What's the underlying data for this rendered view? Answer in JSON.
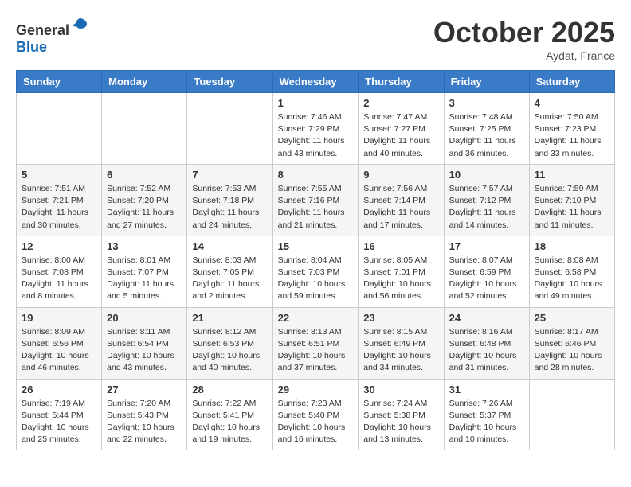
{
  "header": {
    "logo_general": "General",
    "logo_blue": "Blue",
    "month": "October 2025",
    "location": "Aydat, France"
  },
  "columns": [
    "Sunday",
    "Monday",
    "Tuesday",
    "Wednesday",
    "Thursday",
    "Friday",
    "Saturday"
  ],
  "weeks": [
    [
      {
        "day": "",
        "info": ""
      },
      {
        "day": "",
        "info": ""
      },
      {
        "day": "",
        "info": ""
      },
      {
        "day": "1",
        "info": "Sunrise: 7:46 AM\nSunset: 7:29 PM\nDaylight: 11 hours and 43 minutes."
      },
      {
        "day": "2",
        "info": "Sunrise: 7:47 AM\nSunset: 7:27 PM\nDaylight: 11 hours and 40 minutes."
      },
      {
        "day": "3",
        "info": "Sunrise: 7:48 AM\nSunset: 7:25 PM\nDaylight: 11 hours and 36 minutes."
      },
      {
        "day": "4",
        "info": "Sunrise: 7:50 AM\nSunset: 7:23 PM\nDaylight: 11 hours and 33 minutes."
      }
    ],
    [
      {
        "day": "5",
        "info": "Sunrise: 7:51 AM\nSunset: 7:21 PM\nDaylight: 11 hours and 30 minutes."
      },
      {
        "day": "6",
        "info": "Sunrise: 7:52 AM\nSunset: 7:20 PM\nDaylight: 11 hours and 27 minutes."
      },
      {
        "day": "7",
        "info": "Sunrise: 7:53 AM\nSunset: 7:18 PM\nDaylight: 11 hours and 24 minutes."
      },
      {
        "day": "8",
        "info": "Sunrise: 7:55 AM\nSunset: 7:16 PM\nDaylight: 11 hours and 21 minutes."
      },
      {
        "day": "9",
        "info": "Sunrise: 7:56 AM\nSunset: 7:14 PM\nDaylight: 11 hours and 17 minutes."
      },
      {
        "day": "10",
        "info": "Sunrise: 7:57 AM\nSunset: 7:12 PM\nDaylight: 11 hours and 14 minutes."
      },
      {
        "day": "11",
        "info": "Sunrise: 7:59 AM\nSunset: 7:10 PM\nDaylight: 11 hours and 11 minutes."
      }
    ],
    [
      {
        "day": "12",
        "info": "Sunrise: 8:00 AM\nSunset: 7:08 PM\nDaylight: 11 hours and 8 minutes."
      },
      {
        "day": "13",
        "info": "Sunrise: 8:01 AM\nSunset: 7:07 PM\nDaylight: 11 hours and 5 minutes."
      },
      {
        "day": "14",
        "info": "Sunrise: 8:03 AM\nSunset: 7:05 PM\nDaylight: 11 hours and 2 minutes."
      },
      {
        "day": "15",
        "info": "Sunrise: 8:04 AM\nSunset: 7:03 PM\nDaylight: 10 hours and 59 minutes."
      },
      {
        "day": "16",
        "info": "Sunrise: 8:05 AM\nSunset: 7:01 PM\nDaylight: 10 hours and 56 minutes."
      },
      {
        "day": "17",
        "info": "Sunrise: 8:07 AM\nSunset: 6:59 PM\nDaylight: 10 hours and 52 minutes."
      },
      {
        "day": "18",
        "info": "Sunrise: 8:08 AM\nSunset: 6:58 PM\nDaylight: 10 hours and 49 minutes."
      }
    ],
    [
      {
        "day": "19",
        "info": "Sunrise: 8:09 AM\nSunset: 6:56 PM\nDaylight: 10 hours and 46 minutes."
      },
      {
        "day": "20",
        "info": "Sunrise: 8:11 AM\nSunset: 6:54 PM\nDaylight: 10 hours and 43 minutes."
      },
      {
        "day": "21",
        "info": "Sunrise: 8:12 AM\nSunset: 6:53 PM\nDaylight: 10 hours and 40 minutes."
      },
      {
        "day": "22",
        "info": "Sunrise: 8:13 AM\nSunset: 6:51 PM\nDaylight: 10 hours and 37 minutes."
      },
      {
        "day": "23",
        "info": "Sunrise: 8:15 AM\nSunset: 6:49 PM\nDaylight: 10 hours and 34 minutes."
      },
      {
        "day": "24",
        "info": "Sunrise: 8:16 AM\nSunset: 6:48 PM\nDaylight: 10 hours and 31 minutes."
      },
      {
        "day": "25",
        "info": "Sunrise: 8:17 AM\nSunset: 6:46 PM\nDaylight: 10 hours and 28 minutes."
      }
    ],
    [
      {
        "day": "26",
        "info": "Sunrise: 7:19 AM\nSunset: 5:44 PM\nDaylight: 10 hours and 25 minutes."
      },
      {
        "day": "27",
        "info": "Sunrise: 7:20 AM\nSunset: 5:43 PM\nDaylight: 10 hours and 22 minutes."
      },
      {
        "day": "28",
        "info": "Sunrise: 7:22 AM\nSunset: 5:41 PM\nDaylight: 10 hours and 19 minutes."
      },
      {
        "day": "29",
        "info": "Sunrise: 7:23 AM\nSunset: 5:40 PM\nDaylight: 10 hours and 16 minutes."
      },
      {
        "day": "30",
        "info": "Sunrise: 7:24 AM\nSunset: 5:38 PM\nDaylight: 10 hours and 13 minutes."
      },
      {
        "day": "31",
        "info": "Sunrise: 7:26 AM\nSunset: 5:37 PM\nDaylight: 10 hours and 10 minutes."
      },
      {
        "day": "",
        "info": ""
      }
    ]
  ]
}
